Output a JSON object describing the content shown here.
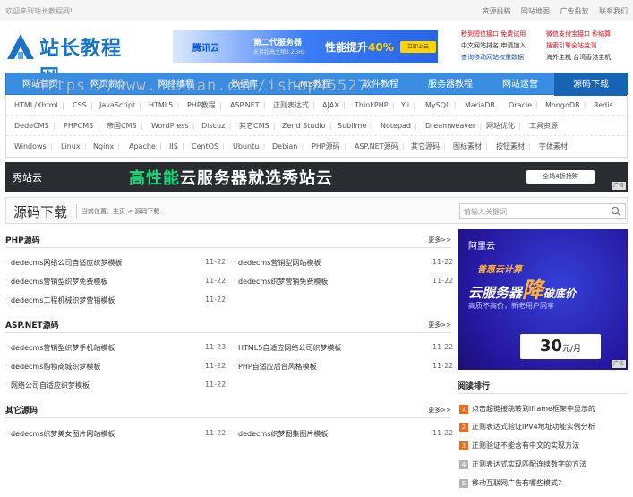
{
  "topbar": {
    "welcome": "欢迎来到站长教程网!",
    "links": [
      "资源投稿",
      "网站地图",
      "广告投放",
      "联系我们"
    ]
  },
  "logo": {
    "text": "站长教程网"
  },
  "top_ad": {
    "brand": "腾讯云",
    "line1": "第二代服务器",
    "line2": "支持超高主频3.2GHz",
    "headline": "性能提升",
    "highlight": "40%",
    "button": "立即上云"
  },
  "text_ads": [
    {
      "text": "秒到短信接口 免费试用",
      "color": "red"
    },
    {
      "text": "微信支付宝接口 秒结算",
      "color": "red"
    },
    {
      "text": "中文网站排名|申请加入",
      "color": "dark"
    },
    {
      "text": "搜索引擎全站监测",
      "color": "red"
    },
    {
      "text": "查询移动网站权重数据",
      "color": "blue"
    },
    {
      "text": "海外主机 台湾香港主机",
      "color": "dark"
    }
  ],
  "nav": {
    "items": [
      "网站首页",
      "网页制作",
      "网络编程",
      "数据库",
      "CMS教程",
      "软件教程",
      "服务器教程",
      "网站运营",
      "源码下载"
    ],
    "active": "源码下载"
  },
  "watermark": "https://www.huzhan.com/ishop45527",
  "tags": [
    [
      "HTML/Xhtml",
      "CSS",
      "JavaScript",
      "HTML5",
      "PHP教程",
      "ASP.NET",
      "正则表达式",
      "AJAX",
      "ThinkPHP",
      "Yii",
      "MySQL",
      "MariaDB",
      "Oracle",
      "MongoDB",
      "Redis"
    ],
    [
      "DedeCMS",
      "PHPCMS",
      "帝国CMS",
      "WordPress",
      "Discuz",
      "其它CMS",
      "Zend Studio",
      "Sublime",
      "Notepad",
      "Dreamweaver",
      "网站优化",
      "工具资源"
    ],
    [
      "Windows",
      "Linux",
      "Nginx",
      "Apache",
      "IIS",
      "CentOS",
      "Ubuntu",
      "Debian",
      "PHP源码",
      "ASP.NET源码",
      "其它源码",
      "图标素材",
      "按钮素材",
      "字体素材"
    ]
  ],
  "banner": {
    "brand": "秀站云",
    "headline_pre": "高性能",
    "headline_post": "云服务器就选秀站云",
    "cta": "全场4折抢购",
    "ad_tag": "广告"
  },
  "page": {
    "title": "源码下载",
    "crumb_label": "当前位置：",
    "crumb_home": "主页",
    "crumb_sep": " > ",
    "crumb_current": "源码下载",
    "search_placeholder": "请输入关键词"
  },
  "sections": [
    {
      "title": "PHP源码",
      "more": "更多>>",
      "left": [
        {
          "title": "dedecms网络公司自适应织梦模板",
          "date": "11-22"
        },
        {
          "title": "dedecms营销型织梦免费模板",
          "date": "11-22"
        },
        {
          "title": "dedecms工程机械织梦营销模板",
          "date": "11-22"
        }
      ],
      "right": [
        {
          "title": "dedecms营销型网站模板",
          "date": "11-22"
        },
        {
          "title": "dedecms织梦营销免费模板",
          "date": "11-22"
        }
      ]
    },
    {
      "title": "ASP.NET源码",
      "more": "更多>>",
      "left": [
        {
          "title": "dedecms营销型织梦手机站模板",
          "date": "11-23"
        },
        {
          "title": "dedecms购物商城织梦模板",
          "date": "11-22"
        },
        {
          "title": "网络公司自适应织梦模板",
          "date": "11-22"
        }
      ],
      "right": [
        {
          "title": "HTML5自适应网络公司织梦模板",
          "date": "11-22"
        },
        {
          "title": "PHP自适应后台风格模板",
          "date": "11-22"
        }
      ]
    },
    {
      "title": "其它源码",
      "more": "更多>>",
      "left": [
        {
          "title": "dedecms织梦美女图片网站模板",
          "date": "11-22"
        }
      ],
      "right": [
        {
          "title": "dedecms织梦图集图片模板",
          "date": "11-22"
        }
      ]
    }
  ],
  "side_ad": {
    "brand": "阿里云",
    "line1": "普惠云计算",
    "line2": "云服务器",
    "big": "降",
    "line3": "破底价",
    "line4": "高质不高价，新老用户同享",
    "price": "30",
    "unit": "元/月",
    "ad_tag": "广告"
  },
  "ranking": {
    "title": "阅读排行",
    "items": [
      {
        "num": "1",
        "title": "点击超链接跳转到iframe框架中显示的"
      },
      {
        "num": "2",
        "title": "正则表达式验证IPV4地址功能实例分析"
      },
      {
        "num": "3",
        "title": "正则验证不能含有中文的实现方法"
      },
      {
        "num": "4",
        "title": "正则表达式实现匹配连续数字的方法"
      },
      {
        "num": "5",
        "title": "移动互联网广告有哪些模式?"
      }
    ]
  },
  "colors": {
    "nav_bg": "#3a8de0",
    "nav_active": "#1763b5",
    "rank_hot": "#f06a1b",
    "rank_normal": "#b5b5b5"
  }
}
